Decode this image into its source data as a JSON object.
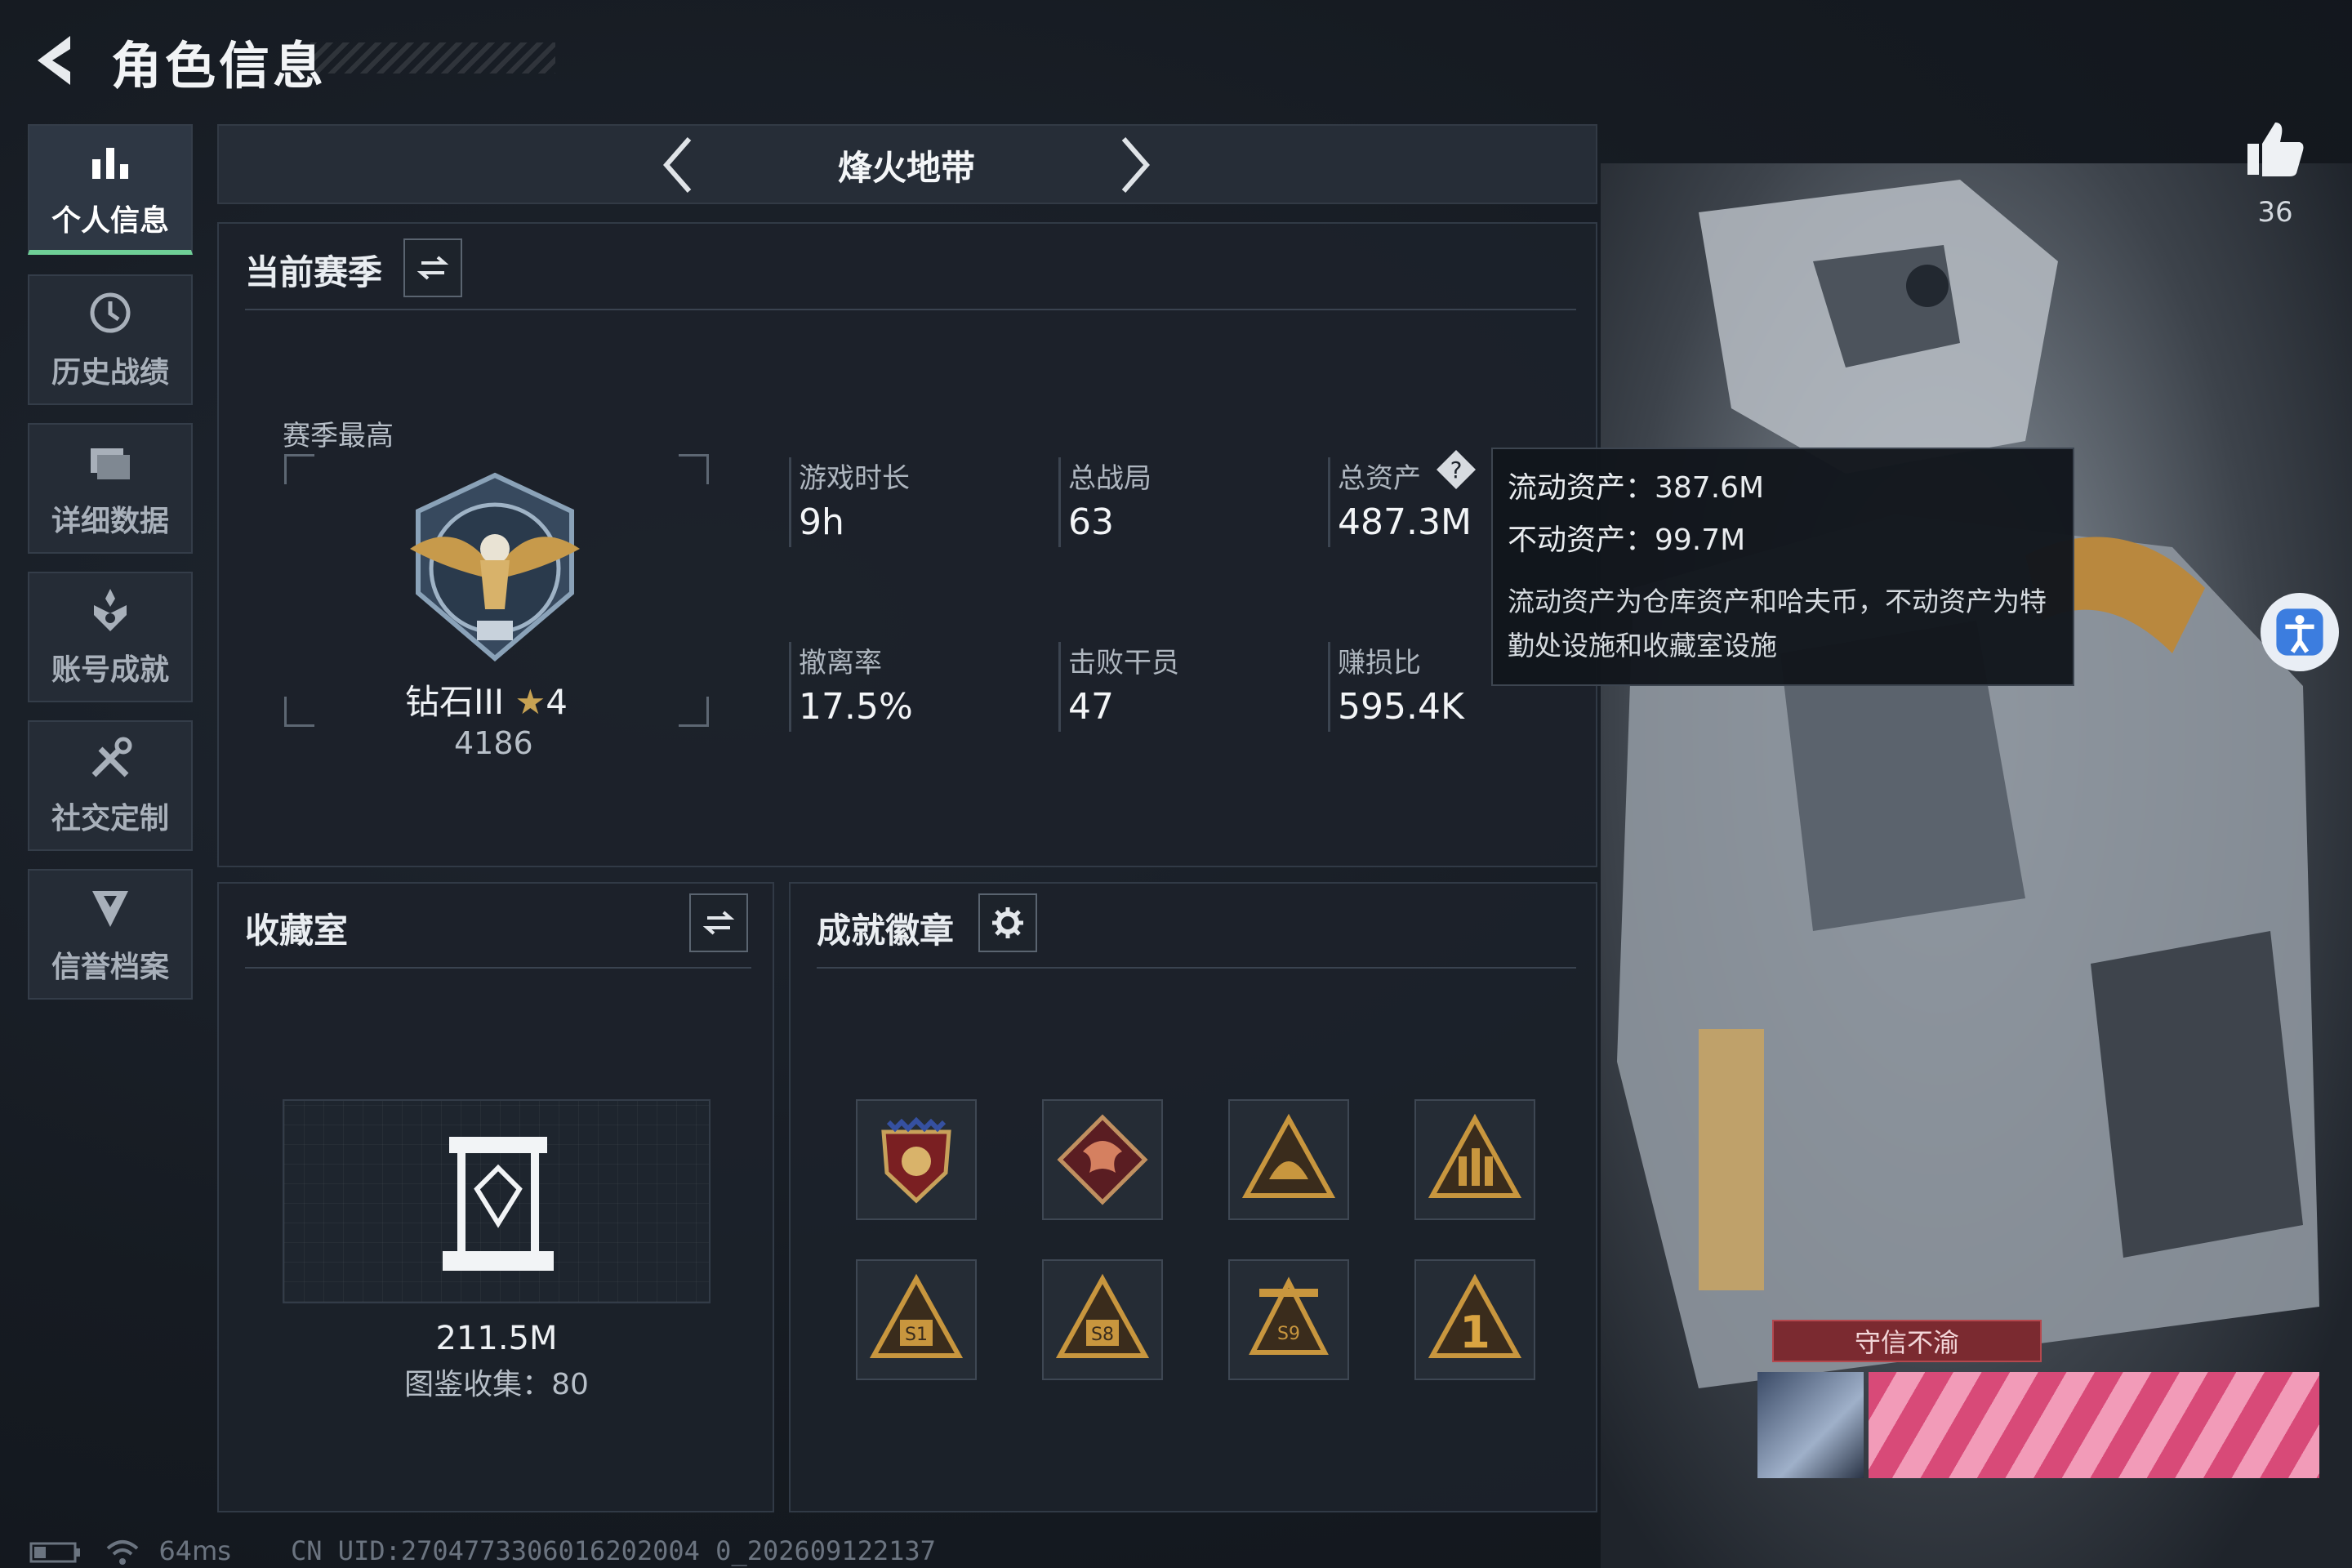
{
  "header": {
    "title": "角色信息"
  },
  "nav": {
    "items": [
      {
        "label": "个人信息",
        "icon": "bar-chart-icon",
        "active": true
      },
      {
        "label": "历史战绩",
        "icon": "history-clock-icon"
      },
      {
        "label": "详细数据",
        "icon": "data-folder-icon"
      },
      {
        "label": "账号成就",
        "icon": "achievement-icon"
      },
      {
        "label": "社交定制",
        "icon": "tools-icon"
      },
      {
        "label": "信誉档案",
        "icon": "credibility-shield-icon"
      }
    ]
  },
  "game_tab": {
    "name": "烽火地带"
  },
  "likes": {
    "count": "36"
  },
  "season": {
    "title": "当前赛季",
    "best_label": "赛季最高",
    "rank_name": "钻石III",
    "rank_stars": "4",
    "rank_score": "4186",
    "stats": [
      {
        "label": "游戏时长",
        "value": "9h"
      },
      {
        "label": "总战局",
        "value": "63"
      },
      {
        "label": "总资产",
        "value": "487.3M"
      },
      {
        "label": "撤离率",
        "value": "17.5%"
      },
      {
        "label": "击败干员",
        "value": "47"
      },
      {
        "label": "赚损比",
        "value": "595.4K"
      }
    ]
  },
  "tooltip": {
    "liquid": "流动资产：387.6M",
    "fixed": "不动资产：99.7M",
    "note": "流动资产为仓库资产和哈夫币，不动资产为特勤处设施和收藏室设施"
  },
  "collection": {
    "title": "收藏室",
    "value": "211.5M",
    "catalog": "图鉴收集：80"
  },
  "badges": {
    "title": "成就徽章",
    "items": [
      "eagle-crest-badge-icon",
      "dragon-badge-icon",
      "helmet-badge-icon",
      "squad-badge-icon",
      "s1-badge-icon",
      "s8-badge-icon",
      "s9-badge-icon",
      "number-one-badge-icon"
    ]
  },
  "title_banner": {
    "label": "守信不渝"
  },
  "footer": {
    "ping": "64ms",
    "uid": "CN UID:2704773306016202004 0_202609122137"
  },
  "colors": {
    "accent": "#6fcf97",
    "bronze": "#b8893f",
    "banner": "#d84a78"
  }
}
